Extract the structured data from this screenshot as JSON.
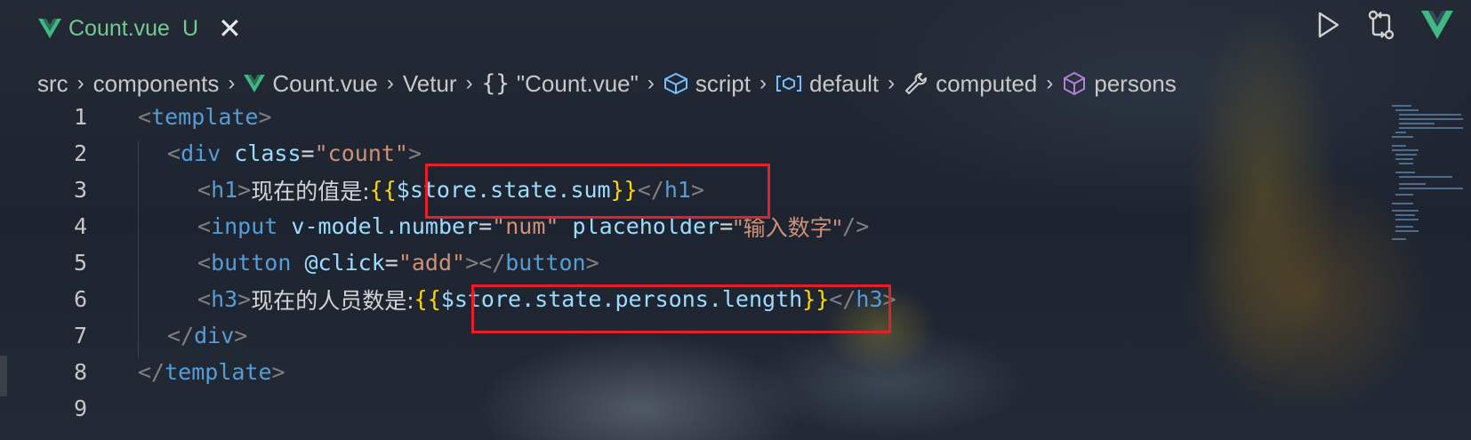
{
  "tab": {
    "title": "Count.vue",
    "status": "U",
    "close_glyph": "✕",
    "color": "#73c991"
  },
  "breadcrumb": {
    "items": [
      "src",
      "components",
      "Count.vue",
      "Vetur",
      "\"Count.vue\"",
      "script",
      "default",
      "computed",
      "persons"
    ],
    "separator": "›",
    "braces_glyph": "{}"
  },
  "editor": {
    "line_numbers": [
      "1",
      "2",
      "3",
      "4",
      "5",
      "6",
      "7",
      "8",
      "9"
    ],
    "lines": {
      "l1": {
        "open": "<",
        "tag": "template",
        "close": ">"
      },
      "l2": {
        "open": "<",
        "tag": "div",
        "attr": "class",
        "eq": "=",
        "value": "\"count\"",
        "close": ">"
      },
      "l3": {
        "open": "<",
        "tag": "h1",
        "close": ">",
        "text": "现在的值是:",
        "lbrace": "{{",
        "expr": "$store.state.sum",
        "rbrace": "}}",
        "end_open": "</",
        "end_tag": "h1",
        "end_close": ">"
      },
      "l4": {
        "open": "<",
        "tag": "input",
        "attr1": "v-model.number",
        "eq": "=",
        "value1": "\"num\"",
        "attr2": "placeholder",
        "value2": "\"输入数字\"",
        "close": "/>"
      },
      "l5": {
        "open": "<",
        "tag": "button",
        "attr": "@click",
        "eq": "=",
        "value": "\"add\"",
        "close": ">",
        "end_open": "</",
        "end_tag": "button",
        "end_close": ">"
      },
      "l6": {
        "open": "<",
        "tag": "h3",
        "close": ">",
        "text": "现在的人员数是:",
        "lbrace": "{{",
        "expr": "$store.state.persons.length",
        "rbrace": "}}",
        "end_open": "</",
        "end_tag": "h3",
        "end_close": ">"
      },
      "l7": {
        "open": "</",
        "tag": "div",
        "close": ">"
      },
      "l8": {
        "open": "</",
        "tag": "template",
        "close": ">"
      }
    }
  },
  "colors": {
    "tag": "#569cd6",
    "attribute": "#9cdcfe",
    "string": "#ce9178",
    "brace": "#ffd700",
    "highlight_box": "#e5202a"
  },
  "icons": {
    "run": "play-icon",
    "compare": "git-compare-icon",
    "vue": "vue-logo-icon"
  }
}
